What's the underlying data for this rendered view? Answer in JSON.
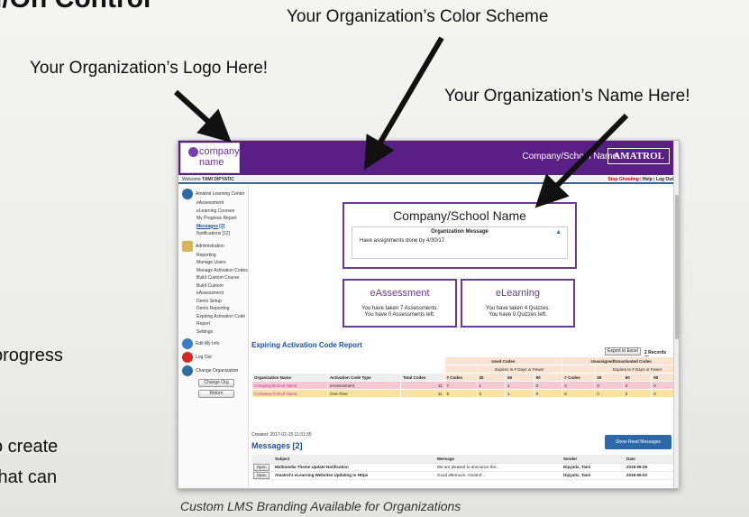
{
  "page": {
    "top_title": "l/On Control",
    "ann_color_scheme": "Your Organization’s Color Scheme",
    "ann_logo": "Your Organization’s Logo Here!",
    "ann_name": "Your Organization’s Name Here!",
    "side_text_1": "progress",
    "side_text_2": "o create",
    "side_text_3": "that can",
    "caption": "Custom LMS Branding Available for Organizations"
  },
  "app": {
    "logo_line1": "company",
    "logo_line2": "name",
    "header_org_name": "Company/School Name",
    "brand": "AMATROL",
    "welcome_prefix": "Welcome",
    "welcome_user": "TAMI DIPYATIC",
    "stop_ghosting": "Stop Ghosting",
    "help": "Help",
    "logout": "Log Out",
    "colors": {
      "header": "#5a1f84",
      "accent": "#6b3a97",
      "link": "#1a4f9c",
      "row_pink": "#f7c8d1",
      "row_gold": "#f9e0a3"
    }
  },
  "sidebar": {
    "learning_center": "Amatrol Learning Center",
    "learning_items": [
      "eAssessment",
      "eLearning Courses",
      "My Progress Report",
      "Messages [2]",
      "Notifications [12]"
    ],
    "admin_head": "Administration",
    "admin_items": [
      "Reporting",
      "Manage Users",
      "Manage Activation Codes",
      "Build Custom Course",
      "Build Custom eAssessment",
      "Demo Setup",
      "Demo Reporting",
      "Expiring Activation Code Report",
      "Settings"
    ],
    "edit_info": "Edit My Info",
    "log_out": "Log Out",
    "change_org_head": "Change Organization",
    "change_org_btn": "Change Org",
    "return_btn": "Return"
  },
  "org_panel": {
    "title": "Company/School Name",
    "message_header": "Organization Message",
    "message_text": "Have assignments done by 4/30/17."
  },
  "cards": [
    {
      "title": "eAssessment",
      "line1": "You have taken 7 Assessments.",
      "line2": "You have 0 Assessments left."
    },
    {
      "title": "eLearning",
      "line1": "You have taken 4 Quizzes.",
      "line2": "You have 0 Quizzes left."
    }
  ],
  "expiring": {
    "title": "Expiring Activation Code Report",
    "export_btn": "Export to Excel",
    "records": "2 Records Shown",
    "group_used": "Used Codes",
    "group_unused": "Unassigned/Unactivated Codes",
    "sub_used": "Expires In # Days or Fewer",
    "sub_unused": "Expires In # Days or Fewer",
    "columns": [
      "Organization Name",
      "Activation Code Type",
      "Total Codes",
      "# Codes",
      "30",
      "60",
      "90",
      "# Codes",
      "30",
      "60",
      "90"
    ],
    "rows": [
      [
        "Company/School Name",
        "eAssessment",
        "11",
        "7",
        "1",
        "1",
        "0",
        "4",
        "0",
        "0",
        "0"
      ],
      [
        "Company/School Name",
        "One-Time",
        "11",
        "5",
        "0",
        "1",
        "0",
        "6",
        "0",
        "2",
        "0"
      ]
    ]
  },
  "messages": {
    "created": "Created: 2017-02-15 11:31:35",
    "title": "Messages [2]",
    "show_btn": "Show Read Messages",
    "columns": [
      "",
      "Subject",
      "Message",
      "Sender",
      "Date"
    ],
    "rows": [
      [
        "Open",
        "Multimedia Theme Update Notification",
        "We are pleased to announce the...",
        "Dipyatic, Tami",
        "2016-06-29"
      ],
      [
        "Open",
        "Amatrol's eLearning Websites Updating to Https",
        "Good afternoon, Amatrol'...",
        "Dipyatic, Tami",
        "2016-06-03"
      ]
    ]
  }
}
